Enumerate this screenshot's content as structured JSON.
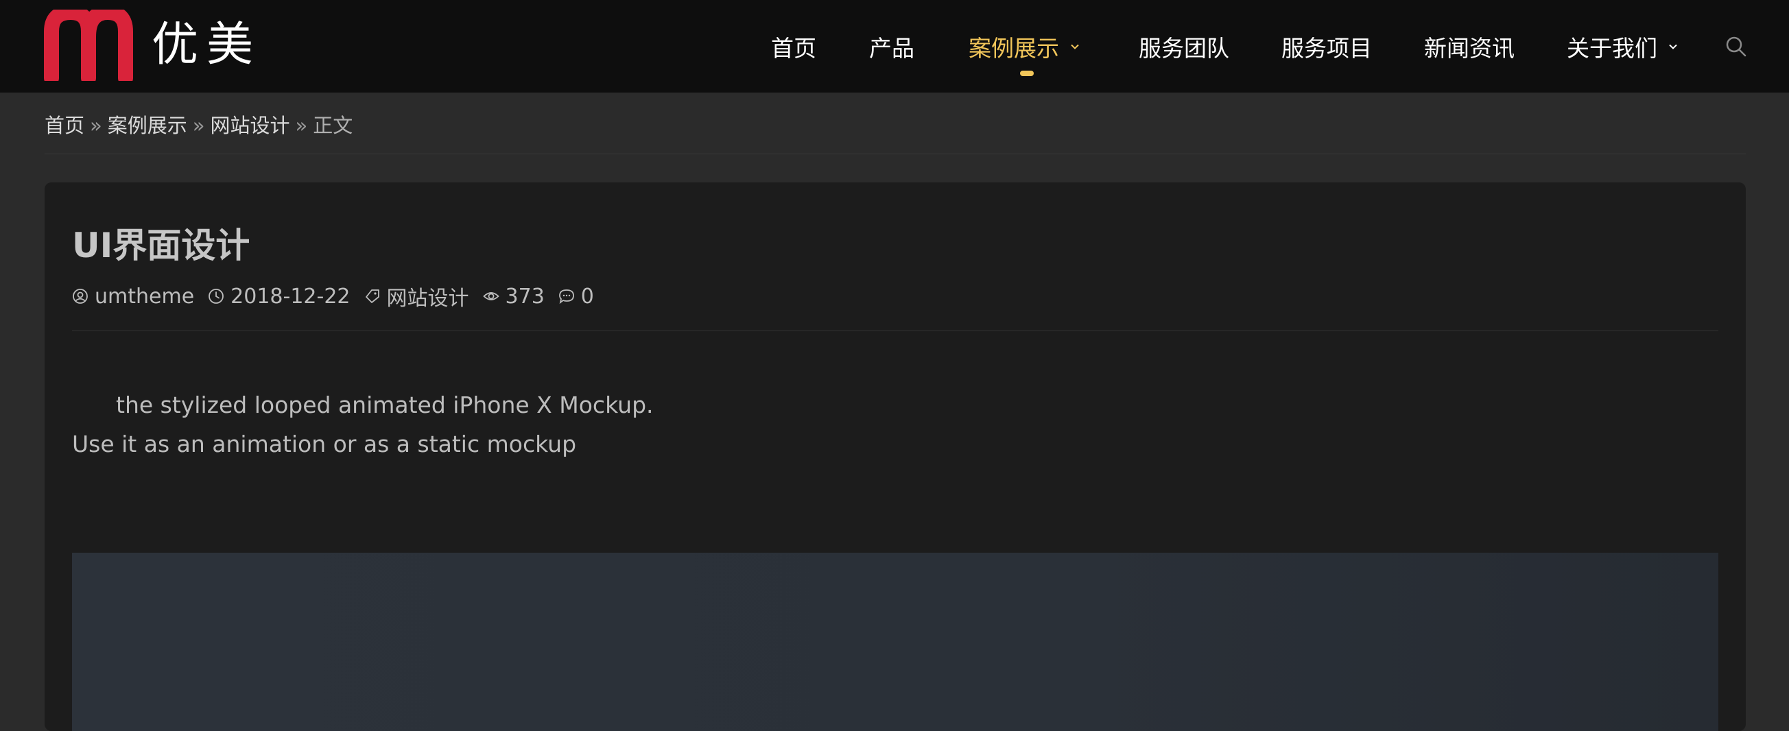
{
  "header": {
    "logo_text": "优美",
    "brand_color": "#d9233a",
    "nav": [
      {
        "label": "首页",
        "active": false,
        "has_dropdown": false
      },
      {
        "label": "产品",
        "active": false,
        "has_dropdown": false
      },
      {
        "label": "案例展示",
        "active": true,
        "has_dropdown": true
      },
      {
        "label": "服务团队",
        "active": false,
        "has_dropdown": false
      },
      {
        "label": "服务项目",
        "active": false,
        "has_dropdown": false
      },
      {
        "label": "新闻资讯",
        "active": false,
        "has_dropdown": false
      },
      {
        "label": "关于我们",
        "active": false,
        "has_dropdown": true
      }
    ],
    "active_color": "#f2c65a",
    "search_icon": "search-icon"
  },
  "breadcrumb": {
    "items": [
      "首页",
      "案例展示",
      "网站设计"
    ],
    "separator": "»",
    "current": "正文"
  },
  "post": {
    "title": "UI界面设计",
    "meta": {
      "author": "umtheme",
      "date": "2018-12-22",
      "category": "网站设计",
      "views": "373",
      "comments": "0"
    },
    "paragraphs": [
      "the stylized looped animated iPhone X Mockup.",
      "Use it as an animation or as a static mockup"
    ]
  }
}
